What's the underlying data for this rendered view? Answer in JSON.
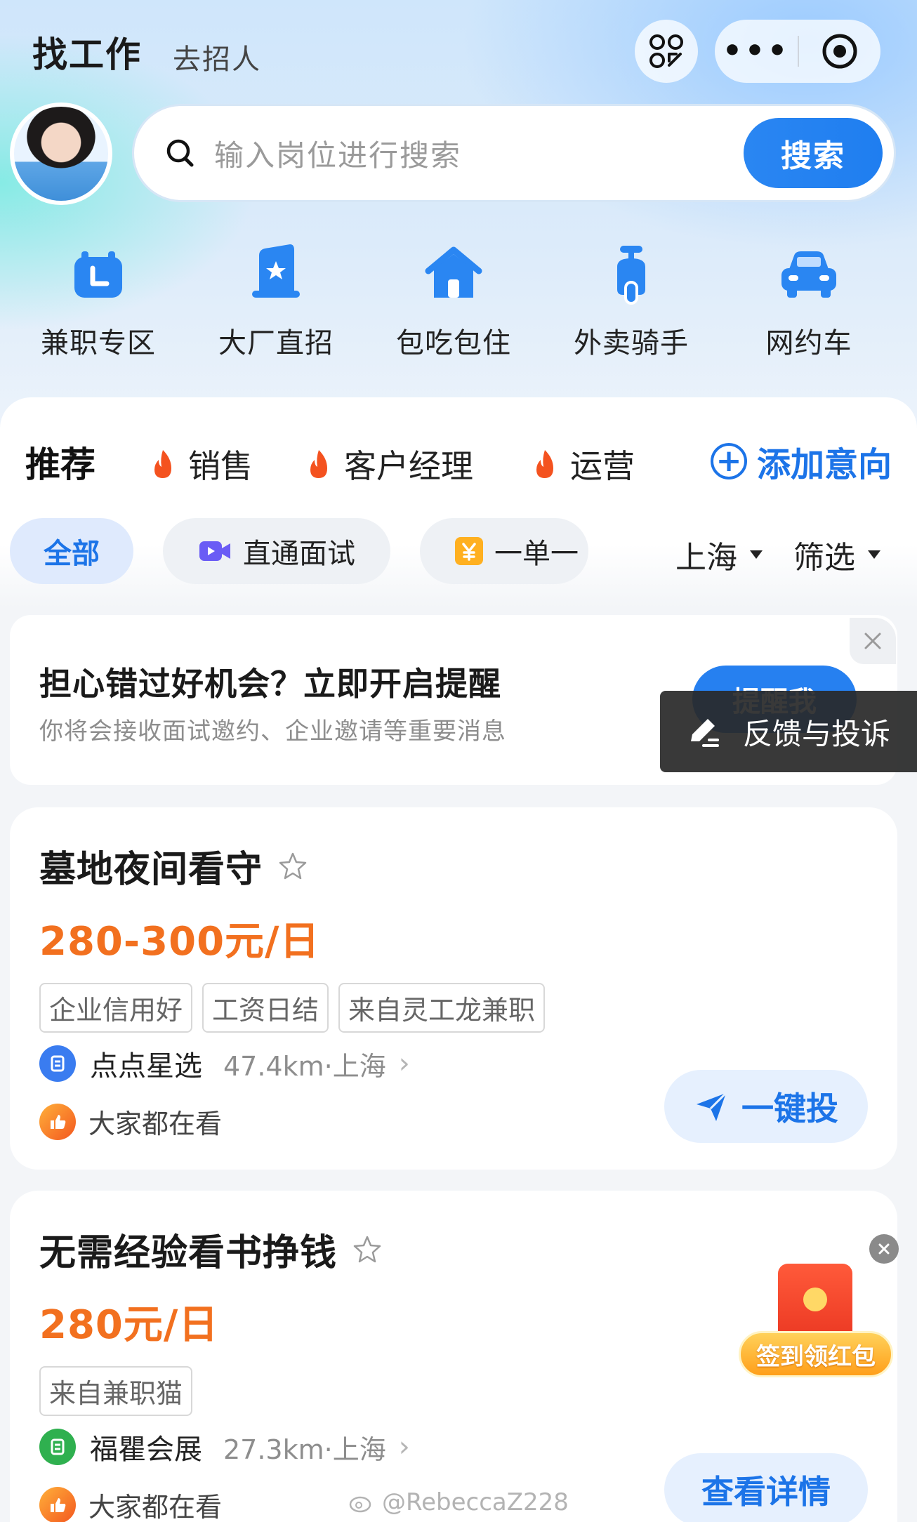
{
  "header": {
    "title": "找工作",
    "subtitle": "去招人",
    "more_label": "•••"
  },
  "search": {
    "placeholder": "输入岗位进行搜索",
    "button_label": "搜索"
  },
  "categories": [
    {
      "label": "兼职专区",
      "icon": "clock-icon",
      "color": "#2a86f2"
    },
    {
      "label": "大厂直招",
      "icon": "star-building-icon",
      "color": "#2a86f2"
    },
    {
      "label": "包吃包住",
      "icon": "house-icon",
      "color": "#2a86f2"
    },
    {
      "label": "外卖骑手",
      "icon": "scooter-icon",
      "color": "#2a86f2"
    },
    {
      "label": "网约车",
      "icon": "car-icon",
      "color": "#2a86f2"
    }
  ],
  "tabs": {
    "recommend": "推荐",
    "items": [
      "销售",
      "客户经理",
      "运营"
    ],
    "add_intent": "添加意向"
  },
  "filters": {
    "chips": [
      "全部",
      "直通面试",
      "一单一"
    ],
    "city": "上海",
    "filter": "筛选"
  },
  "reminder": {
    "title": "担心错过好机会？立即开启提醒",
    "desc": "你将会接收面试邀约、企业邀请等重要消息",
    "button": "提醒我"
  },
  "feedback": {
    "label": "反馈与投诉"
  },
  "jobs": [
    {
      "title": "墓地夜间看守",
      "salary": "280-300元/日",
      "tags": [
        "企业信用好",
        "工资日结",
        "来自灵工龙兼职"
      ],
      "company": "点点星选",
      "distance": "47.4km·上海",
      "watch": "大家都在看",
      "action": "一键投"
    },
    {
      "title": "无需经验看书挣钱",
      "salary": "280元/日",
      "tags": [
        "来自兼职猫"
      ],
      "company": "福瞿会展",
      "distance": "27.3km·上海",
      "watch": "大家都在看",
      "action": "查看详情"
    }
  ],
  "red_packet": {
    "label": "签到领红包"
  },
  "watermark": "@RebeccaZ228",
  "colors": {
    "accent": "#1c74e8",
    "salary": "#f2701f",
    "flame": "#f4521f"
  }
}
